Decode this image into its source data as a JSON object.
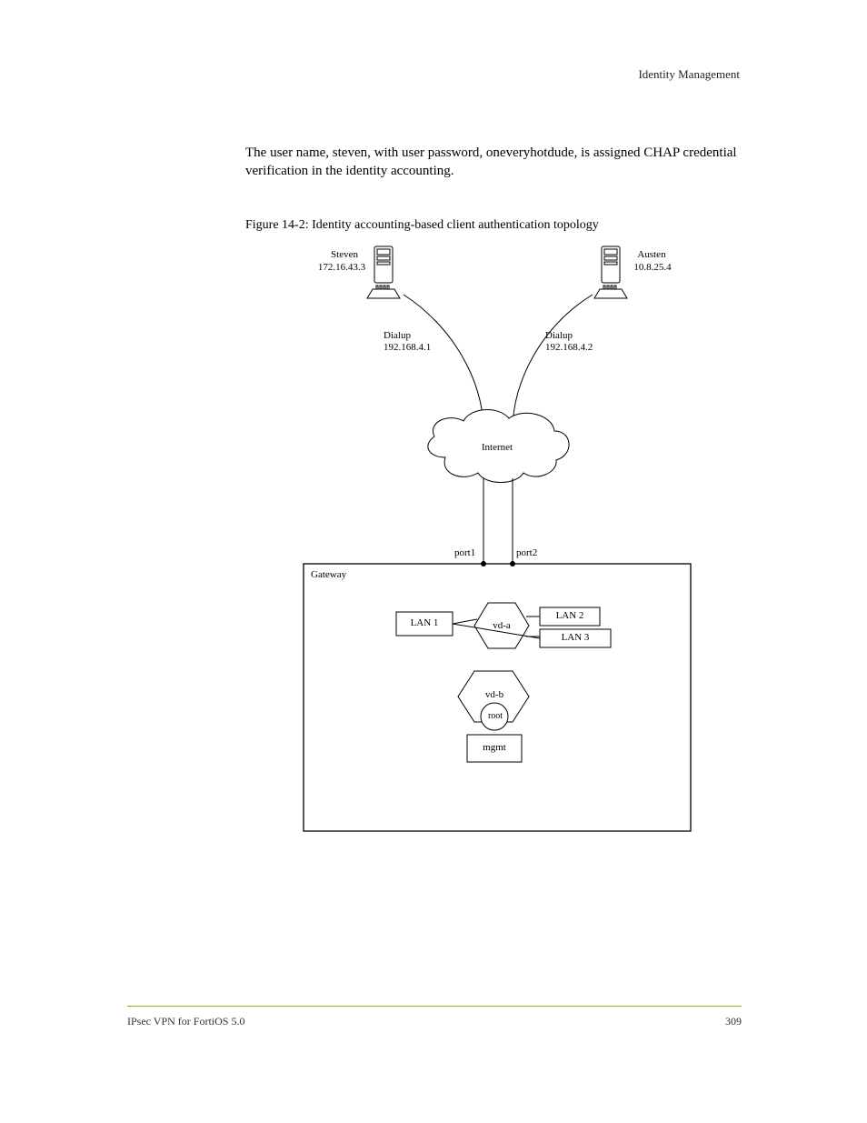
{
  "header": {
    "section": "Identity Management"
  },
  "body": {
    "paragraph": "The user name, steven, with user password, oneveryhotdude, is assigned CHAP credential verification in the identity accounting."
  },
  "figure": {
    "title": "Figure 14-2: Identity accounting-based client authentication topology",
    "servers": {
      "left": {
        "top": "Steven",
        "bottom": "172.16.43.3"
      },
      "right": {
        "top": "Austen",
        "bottom": "10.8.25.4"
      }
    },
    "dialup": {
      "left": "Dialup\n192.168.4.1",
      "right": "Dialup\n192.168.4.2"
    },
    "cloud": "Internet",
    "gateway": {
      "ports": {
        "port1": "port1",
        "port2": "port2"
      },
      "box": "Gateway",
      "lan_l": "LAN 1",
      "hexLeft": "vd-a",
      "lan_r1": "LAN 2",
      "lan_r2": "LAN 3",
      "hexBottom": "vd-b",
      "root": "root",
      "mgmt": "mgmt"
    }
  },
  "footer": {
    "product": "IPsec VPN for FortiOS 5.0",
    "page": "309"
  }
}
